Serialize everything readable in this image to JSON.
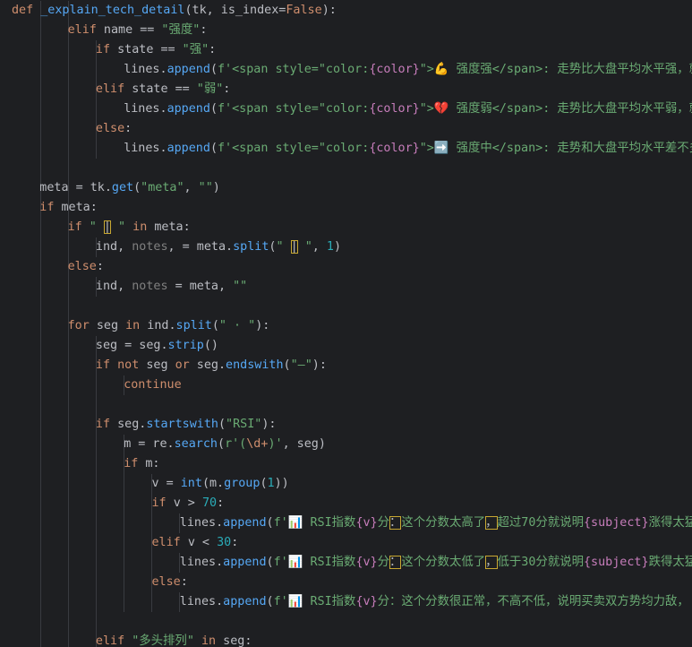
{
  "editor": {
    "lines": [
      [
        [
          "kw",
          "def "
        ],
        [
          "fn",
          "_explain_tech_detail"
        ],
        [
          "",
          "(tk, is_index="
        ],
        [
          "kw",
          "False"
        ],
        [
          "",
          "):"
        ]
      ],
      [
        [
          "kw",
          "elif "
        ],
        [
          "",
          "name == "
        ],
        [
          "str",
          "\"强度\""
        ],
        [
          "",
          ":"
        ]
      ],
      [
        [
          "kw",
          "if "
        ],
        [
          "",
          "state == "
        ],
        [
          "str",
          "\"强\""
        ],
        [
          "",
          ":"
        ]
      ],
      [
        [
          "",
          "lines."
        ],
        [
          "fn",
          "append"
        ],
        [
          "",
          "("
        ],
        [
          "str",
          "f'<span style=\"color:"
        ],
        [
          "var",
          "{color}"
        ],
        [
          "str",
          "\">💪 强度强</span>: 走势比大盘平均水平强，就"
        ]
      ],
      [
        [
          "kw",
          "elif "
        ],
        [
          "",
          "state == "
        ],
        [
          "str",
          "\"弱\""
        ],
        [
          "",
          ":"
        ]
      ],
      [
        [
          "",
          "lines."
        ],
        [
          "fn",
          "append"
        ],
        [
          "",
          "("
        ],
        [
          "str",
          "f'<span style=\"color:"
        ],
        [
          "var",
          "{color}"
        ],
        [
          "str",
          "\">💔 强度弱</span>: 走势比大盘平均水平弱，就"
        ]
      ],
      [
        [
          "kw",
          "else"
        ],
        [
          "",
          ":"
        ]
      ],
      [
        [
          "",
          "lines."
        ],
        [
          "fn",
          "append"
        ],
        [
          "",
          "("
        ],
        [
          "str",
          "f'<span style=\"color:"
        ],
        [
          "var",
          "{color}"
        ],
        [
          "str",
          "\">➡️ 强度中</span>: 走势和大盘平均水平差不多"
        ]
      ],
      [],
      [
        [
          "",
          "meta = tk."
        ],
        [
          "fn",
          "get"
        ],
        [
          "",
          "("
        ],
        [
          "str",
          "\"meta\""
        ],
        [
          "",
          ", "
        ],
        [
          "str",
          "\"\""
        ],
        [
          "",
          ")"
        ]
      ],
      [
        [
          "kw",
          "if "
        ],
        [
          "",
          "meta:"
        ]
      ],
      [
        [
          "kw",
          "if "
        ],
        [
          "str",
          "\" "
        ],
        [
          "sel",
          "|"
        ],
        [
          "str",
          " \""
        ],
        [
          "kw",
          " in "
        ],
        [
          "",
          "meta:"
        ]
      ],
      [
        [
          "",
          "ind, "
        ],
        [
          "unused",
          "notes"
        ],
        [
          "",
          ", = meta."
        ],
        [
          "fn",
          "split"
        ],
        [
          "",
          "("
        ],
        [
          "str",
          "\" "
        ],
        [
          "sel",
          "|"
        ],
        [
          "str",
          " \""
        ],
        [
          "",
          ", "
        ],
        [
          "num",
          "1"
        ],
        [
          "",
          ")"
        ]
      ],
      [
        [
          "kw",
          "else"
        ],
        [
          "",
          ":"
        ]
      ],
      [
        [
          "",
          "ind, "
        ],
        [
          "unused",
          "notes"
        ],
        [
          "",
          " = meta, "
        ],
        [
          "str",
          "\"\""
        ]
      ],
      [],
      [
        [
          "kw",
          "for "
        ],
        [
          "",
          "seg "
        ],
        [
          "kw",
          "in "
        ],
        [
          "",
          "ind."
        ],
        [
          "fn",
          "split"
        ],
        [
          "",
          "("
        ],
        [
          "str",
          "\" · \""
        ],
        [
          "",
          "):"
        ]
      ],
      [
        [
          "",
          "seg = seg."
        ],
        [
          "fn",
          "strip"
        ],
        [
          "",
          "()"
        ]
      ],
      [
        [
          "kw",
          "if not "
        ],
        [
          "",
          "seg "
        ],
        [
          "kw",
          "or "
        ],
        [
          "",
          "seg."
        ],
        [
          "fn",
          "endswith"
        ],
        [
          "",
          "("
        ],
        [
          "str",
          "\"—\""
        ],
        [
          "",
          "):"
        ]
      ],
      [
        [
          "kw",
          "continue"
        ]
      ],
      [],
      [
        [
          "kw",
          "if "
        ],
        [
          "",
          "seg."
        ],
        [
          "fn",
          "startswith"
        ],
        [
          "",
          "("
        ],
        [
          "str",
          "\"RSI\""
        ],
        [
          "",
          "):"
        ]
      ],
      [
        [
          "",
          "m = re."
        ],
        [
          "fn",
          "search"
        ],
        [
          "",
          "("
        ],
        [
          "str",
          "r'("
        ],
        [
          "esc",
          "\\d+"
        ],
        [
          "str",
          ")'"
        ],
        [
          "",
          ", seg)"
        ]
      ],
      [
        [
          "kw",
          "if "
        ],
        [
          "",
          "m:"
        ]
      ],
      [
        [
          "",
          "v = "
        ],
        [
          "fn",
          "int"
        ],
        [
          "",
          "(m."
        ],
        [
          "fn",
          "group"
        ],
        [
          "",
          "("
        ],
        [
          "num",
          "1"
        ],
        [
          "",
          "))"
        ]
      ],
      [
        [
          "kw",
          "if "
        ],
        [
          "",
          "v > "
        ],
        [
          "num",
          "70"
        ],
        [
          "",
          ":"
        ]
      ],
      [
        [
          "",
          "lines."
        ],
        [
          "fn",
          "append"
        ],
        [
          "",
          "("
        ],
        [
          "str",
          "f'📊 RSI指数"
        ],
        [
          "var",
          "{v}"
        ],
        [
          "str",
          "分"
        ],
        [
          "sel",
          "："
        ],
        [
          "str",
          "这个分数太高了"
        ],
        [
          "sel",
          "，"
        ],
        [
          "str",
          "超过70分就说明"
        ],
        [
          "var",
          "{subject}"
        ],
        [
          "str",
          "涨得太猛"
        ]
      ],
      [
        [
          "kw",
          "elif "
        ],
        [
          "",
          "v < "
        ],
        [
          "num",
          "30"
        ],
        [
          "",
          ":"
        ]
      ],
      [
        [
          "",
          "lines."
        ],
        [
          "fn",
          "append"
        ],
        [
          "",
          "("
        ],
        [
          "str",
          "f'📊 RSI指数"
        ],
        [
          "var",
          "{v}"
        ],
        [
          "str",
          "分"
        ],
        [
          "sel",
          "："
        ],
        [
          "str",
          "这个分数太低了"
        ],
        [
          "sel",
          "，"
        ],
        [
          "str",
          "低于30分就说明"
        ],
        [
          "var",
          "{subject}"
        ],
        [
          "str",
          "跌得太猛"
        ]
      ],
      [
        [
          "kw",
          "else"
        ],
        [
          "",
          ":"
        ]
      ],
      [
        [
          "",
          "lines."
        ],
        [
          "fn",
          "append"
        ],
        [
          "",
          "("
        ],
        [
          "str",
          "f'📊 RSI指数"
        ],
        [
          "var",
          "{v}"
        ],
        [
          "str",
          "分：这个分数很正常，不高不低，说明买卖双方势均力敌，"
        ]
      ],
      [],
      [
        [
          "kw",
          "elif "
        ],
        [
          "str",
          "\"多头排列\""
        ],
        [
          "kw",
          " in "
        ],
        [
          "",
          "seg:"
        ]
      ]
    ]
  }
}
